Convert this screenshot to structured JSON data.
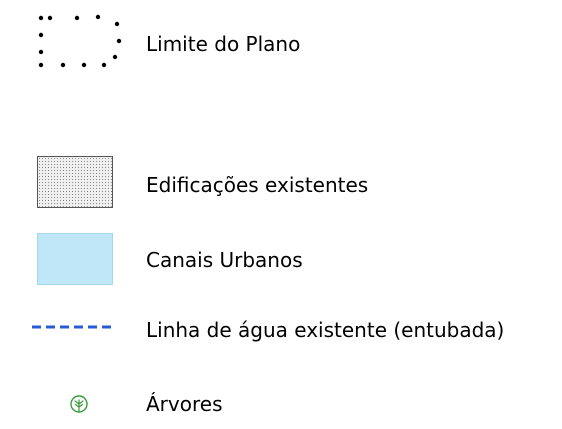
{
  "legend": {
    "items": [
      {
        "label": "Limite do Plano",
        "icon": "dotted-boundary-icon",
        "color": "#000000"
      },
      {
        "label": "Edificações existentes",
        "icon": "stippled-building-icon",
        "color": "#8a8a8a"
      },
      {
        "label": "Canais Urbanos",
        "icon": "water-canal-swatch",
        "color": "#bfe7f8"
      },
      {
        "label": "Linha de água existente (entubada)",
        "icon": "dashed-line-icon",
        "color": "#2a5bd7"
      },
      {
        "label": "Árvores",
        "icon": "tree-icon",
        "color": "#3a9a3a"
      }
    ]
  }
}
